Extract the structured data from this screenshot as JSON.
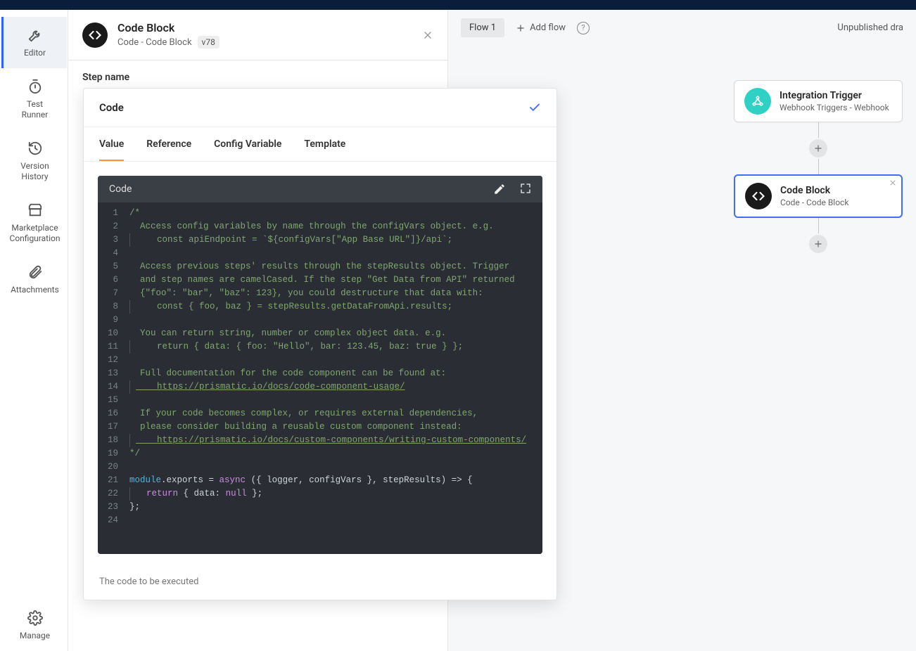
{
  "sidebar": {
    "items": [
      {
        "label": "Editor"
      },
      {
        "label": "Test\nRunner"
      },
      {
        "label": "Version\nHistory"
      },
      {
        "label": "Marketplace\nConfiguration"
      },
      {
        "label": "Attachments"
      }
    ],
    "manage_label": "Manage"
  },
  "step_panel": {
    "title": "Code Block",
    "subtitle": "Code - Code Block",
    "version": "v78",
    "body_label": "Step name"
  },
  "canvas": {
    "flow_tab": "Flow 1",
    "add_flow": "Add flow",
    "status": "Unpublished dra",
    "nodes": [
      {
        "title": "Integration Trigger",
        "subtitle": "Webhook Triggers - Webhook"
      },
      {
        "title": "Code Block",
        "subtitle": "Code - Code Block"
      }
    ]
  },
  "drawer": {
    "title": "Code",
    "tabs": [
      "Value",
      "Reference",
      "Config Variable",
      "Template"
    ],
    "editor_label": "Code",
    "help": "The code to be executed"
  },
  "code": {
    "l1": "/*",
    "l2": "  Access config variables by name through the configVars object. e.g.",
    "l3a": "    const apiEndpoint = `${configVars[",
    "l3b": "\"App Base URL\"",
    "l3c": "]}/api`;",
    "l4": "",
    "l5": "  Access previous steps' results through the stepResults object. Trigger",
    "l6": "  and step names are camelCased. If the step \"Get Data from API\" returned",
    "l7": "  {\"foo\": \"bar\", \"baz\": 123}, you could destructure that data with:",
    "l8": "    const { foo, baz } = stepResults.getDataFromApi.results;",
    "l9": "",
    "l10": "  You can return string, number or complex object data. e.g.",
    "l11": "    return { data: { foo: \"Hello\", bar: 123.45, baz: true } };",
    "l12": "",
    "l13": "  Full documentation for the code component can be found at:",
    "l14": "    https://prismatic.io/docs/code-component-usage/",
    "l15": "",
    "l16": "  If your code becomes complex, or requires external dependencies,",
    "l17": "  please consider building a reusable custom component instead:",
    "l18": "    https://prismatic.io/docs/custom-components/writing-custom-components/",
    "l19": "*/",
    "l20": "",
    "l21_a": "module",
    "l21_b": ".exports = ",
    "l21_c": "async",
    "l21_d": " ({ logger, configVars }, stepResults) => {",
    "l22_a": "  ",
    "l22_b": "return",
    "l22_c": " { data: ",
    "l22_d": "null",
    "l22_e": " };",
    "l23": "};",
    "l24": ""
  }
}
